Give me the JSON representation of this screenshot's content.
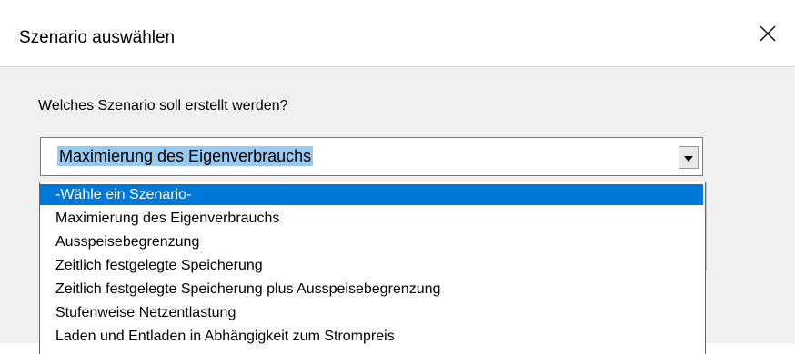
{
  "dialog": {
    "title": "Szenario auswählen",
    "close_icon": "close-icon",
    "question": "Welches Szenario soll erstellt werden?"
  },
  "combo": {
    "selected_value": "Maximierung des Eigenverbrauchs",
    "arrow_icon": "dropdown-arrow-icon",
    "options": [
      "-Wähle ein Szenario-",
      "Maximierung des Eigenverbrauchs",
      "Ausspeisebegrenzung",
      "Zeitlich festgelegte Speicherung",
      "Zeitlich festgelegte Speicherung plus Ausspeisebegrenzung",
      "Stufenweise Netzentlastung",
      "Laden und Entladen in Abhängigkeit zum Strompreis"
    ],
    "highlighted_index": 0
  },
  "colors": {
    "highlight": "#0078d7",
    "selected_text_bg": "#99c9ef",
    "dialog_bg": "#f0f0f0"
  }
}
